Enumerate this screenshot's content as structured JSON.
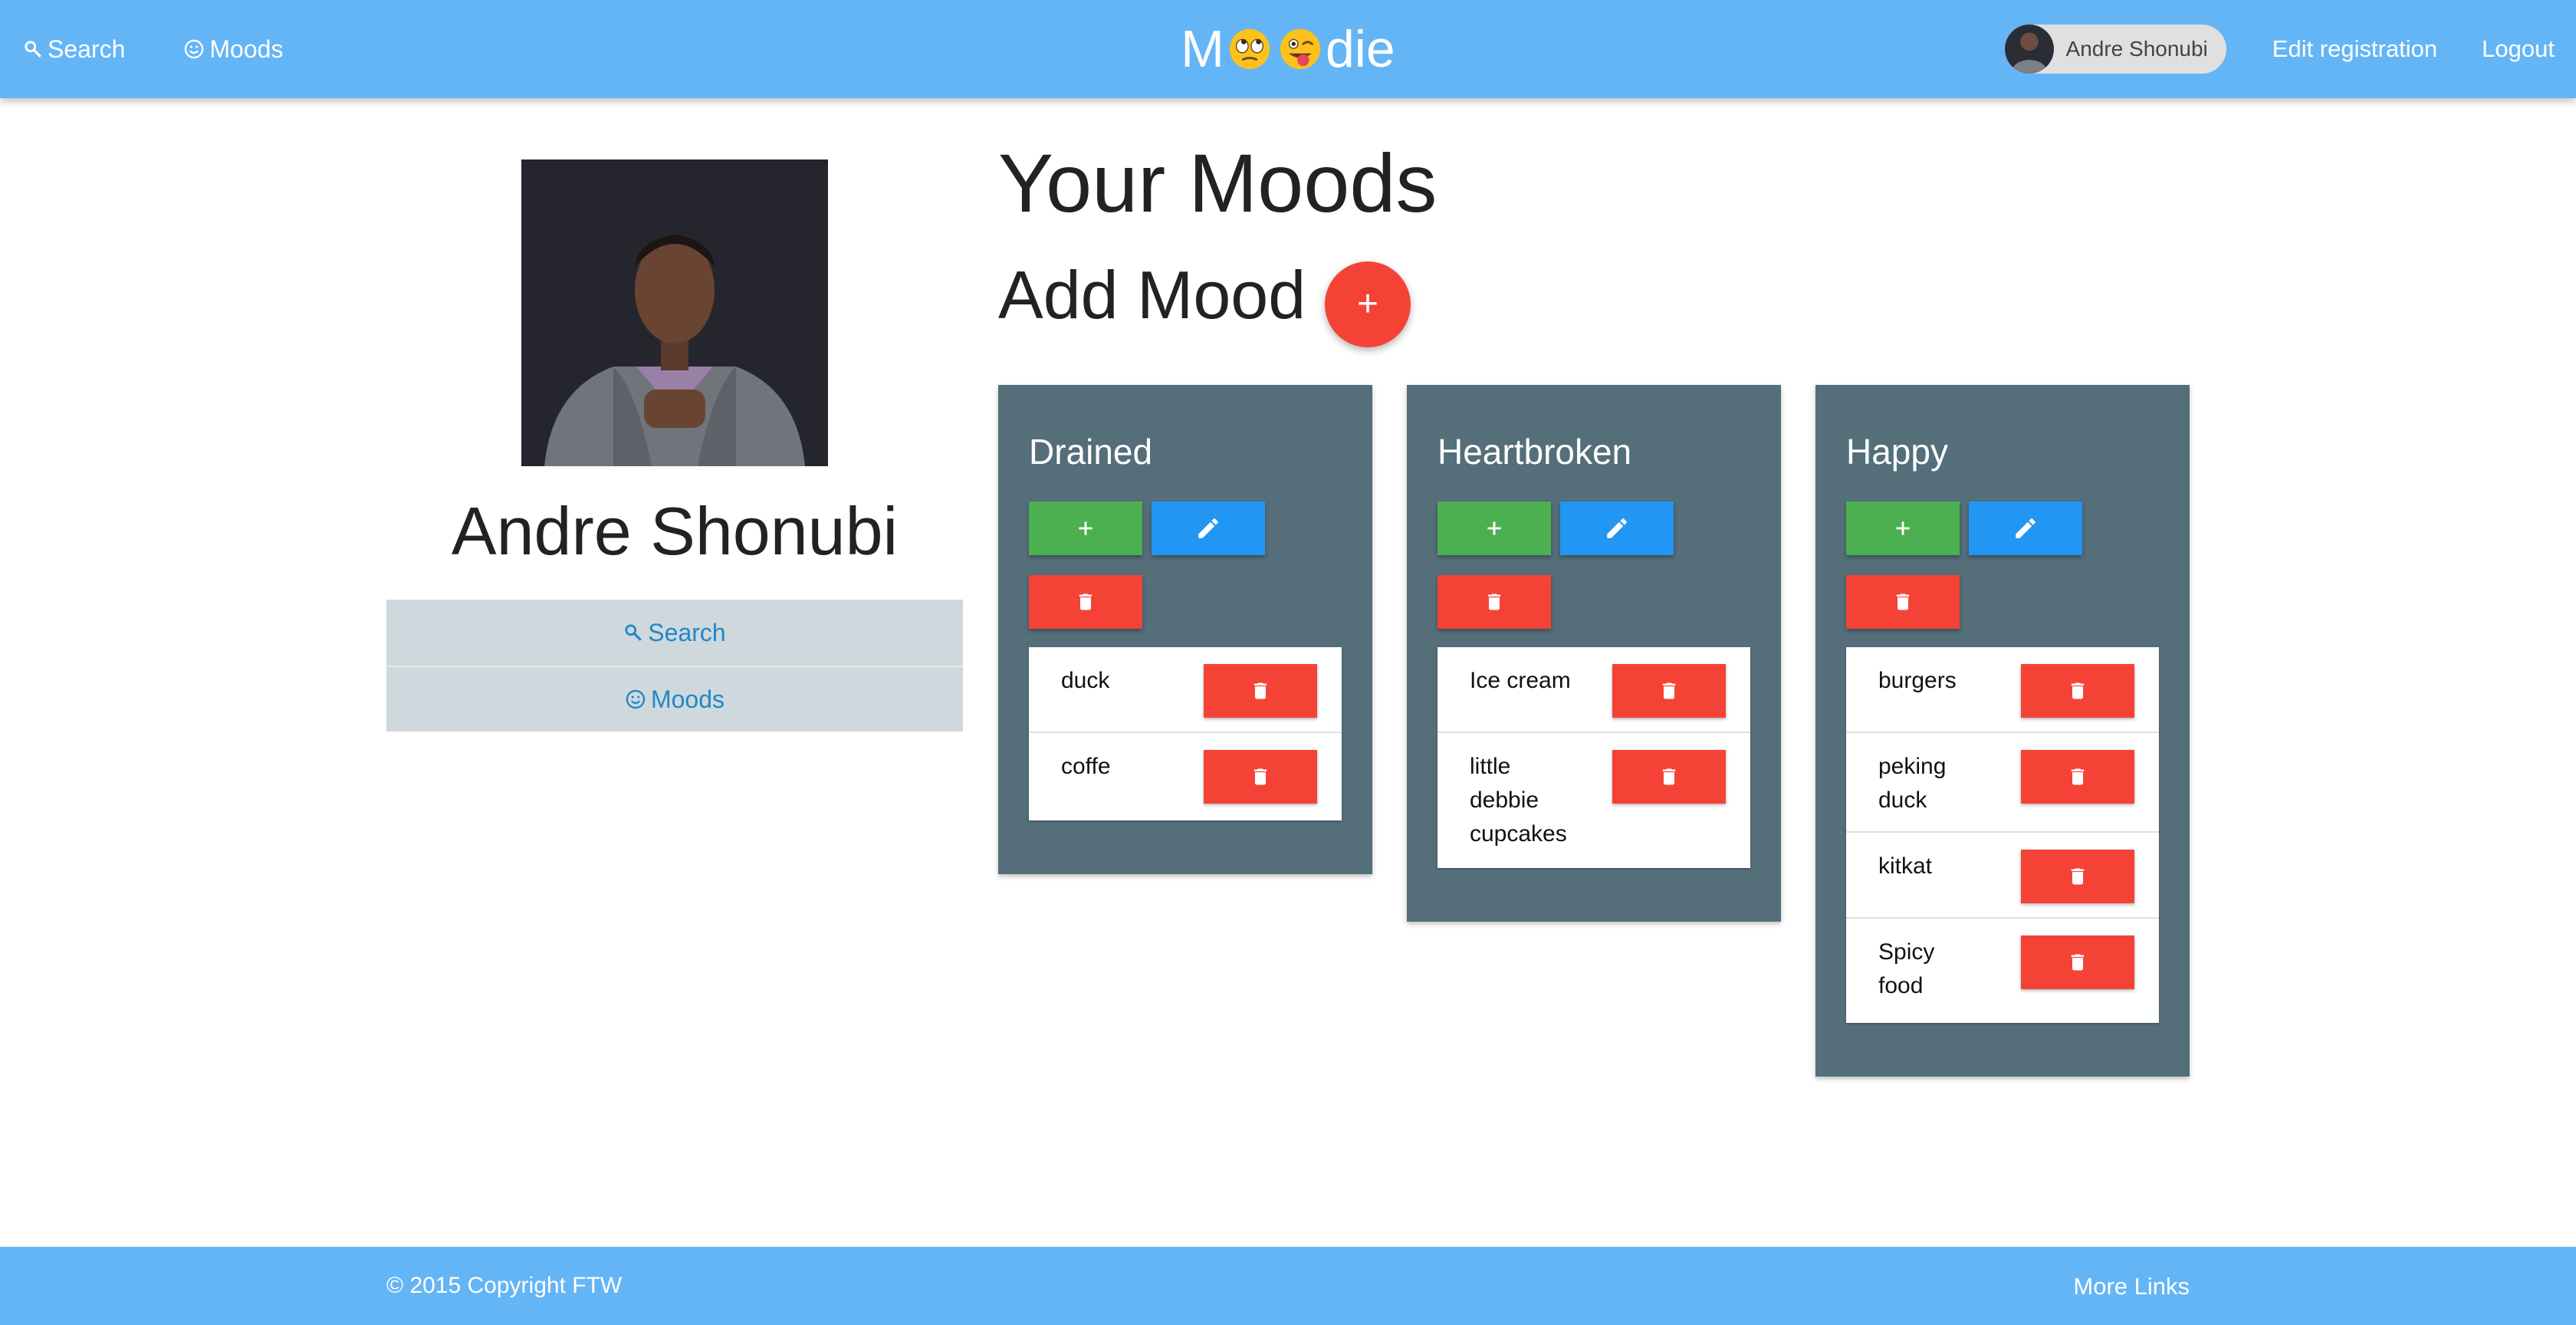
{
  "nav": {
    "search_label": "Search",
    "moods_label": "Moods",
    "brand_prefix": "M",
    "brand_suffix": "die",
    "user_name": "Andre Shonubi",
    "edit_label": "Edit registration",
    "logout_label": "Logout"
  },
  "profile": {
    "name": "Andre Shonubi",
    "menu": [
      {
        "label": "Search",
        "icon": "search-icon"
      },
      {
        "label": "Moods",
        "icon": "smiley-icon"
      }
    ]
  },
  "main": {
    "title": "Your Moods",
    "add_heading": "Add Mood",
    "add_button": "+",
    "moods": [
      {
        "name": "Drained",
        "items": [
          [
            "duck"
          ],
          [
            "coffe"
          ]
        ]
      },
      {
        "name": "Heartbroken",
        "items": [
          [
            "Ice cream"
          ],
          [
            "little",
            "debbie",
            "cupcakes"
          ]
        ]
      },
      {
        "name": "Happy",
        "items": [
          [
            "burgers"
          ],
          [
            "peking",
            "duck"
          ],
          [
            "kitkat"
          ],
          [
            "Spicy",
            "food"
          ]
        ]
      }
    ]
  },
  "footer": {
    "copyright": "© 2015 Copyright FTW",
    "more_links": "More Links"
  },
  "colors": {
    "primary": "#64b5f6",
    "card": "#546e7a",
    "add": "#4caf50",
    "edit": "#2196f3",
    "delete": "#f44336",
    "side_menu": "#cfd8dc",
    "side_link": "#1e88c8"
  }
}
